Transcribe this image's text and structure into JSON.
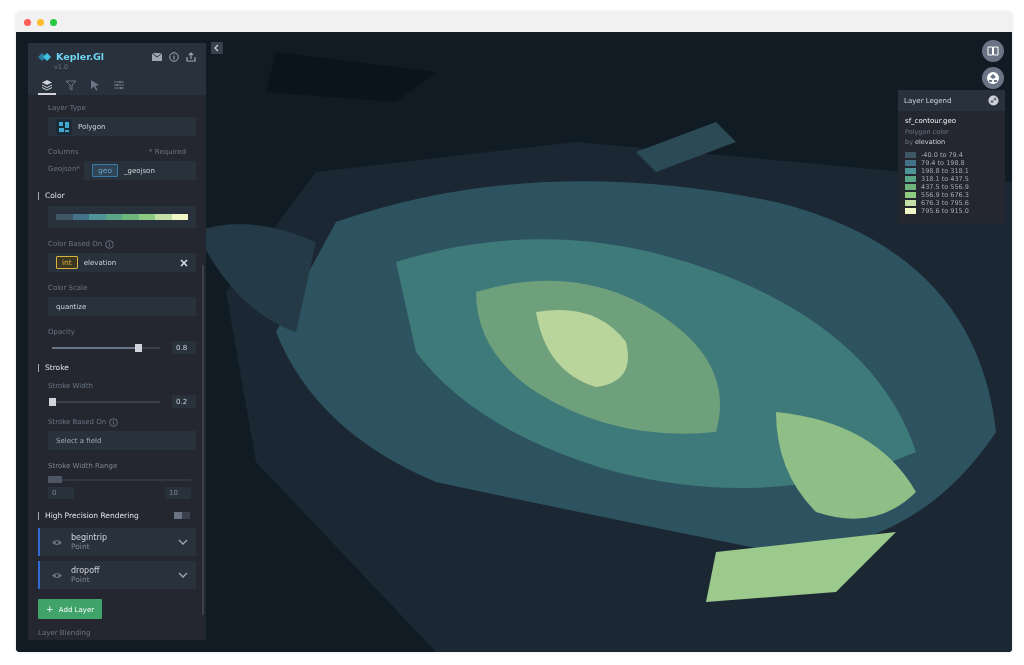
{
  "window": {
    "controls": [
      {
        "color": "#ff5f57"
      },
      {
        "color": "#febc2e"
      },
      {
        "color": "#28c840"
      }
    ]
  },
  "sidebar": {
    "brand": "Kepler.Gl",
    "version": "v1.0",
    "tabs": [
      {
        "kind": "layers",
        "selected": true
      },
      {
        "kind": "filters",
        "selected": false
      },
      {
        "kind": "interactions",
        "selected": false
      },
      {
        "kind": "settings",
        "selected": false
      }
    ],
    "layer_type": {
      "label": "Layer Type",
      "value": "Polygon"
    },
    "columns": {
      "label": "Columns",
      "note": "* Required",
      "field_label": "Geojson*",
      "tag": "geo",
      "value": "_geojson"
    },
    "color": {
      "title": "Color",
      "swatches": [
        {
          "color": "#3e5666"
        },
        {
          "color": "#44728a"
        },
        {
          "color": "#4f9598"
        },
        {
          "color": "#5aa586"
        },
        {
          "color": "#6db57c"
        },
        {
          "color": "#8fca82"
        },
        {
          "color": "#c3dfa6"
        },
        {
          "color": "#f0f6c6"
        }
      ]
    },
    "color_based_on": {
      "label": "Color Based On",
      "tag": "int",
      "value": "elevation"
    },
    "color_scale": {
      "label": "Color Scale",
      "value": "quantize"
    },
    "opacity": {
      "label": "Opacity",
      "level": 0.8,
      "reading": "0.8"
    },
    "stroke": {
      "title": "Stroke",
      "width_label": "Stroke Width",
      "level": 0.0,
      "reading": "0.2"
    },
    "stroke_based_on": {
      "label": "Stroke Based On",
      "placeholder": "Select a field"
    },
    "stroke_width_range": {
      "label": "Stroke Width Range",
      "disabled": true,
      "level": 0.1,
      "min": "0",
      "max": "10"
    },
    "high_precision": {
      "label": "High Precision Rendering",
      "on": false
    },
    "layers": [
      {
        "name": "begintrip",
        "type": "Point"
      },
      {
        "name": "dropoff",
        "type": "Point"
      }
    ],
    "add_layer": "Add Layer",
    "add_symbol": "+",
    "layer_blending": "Layer Blending"
  },
  "legend": {
    "title": "Layer Legend",
    "dataset": "sf_contour.geo",
    "subtitle": "Polygon color",
    "by": "by",
    "field": "elevation",
    "items": [
      {
        "color": "#3e5666",
        "label": "-40.0 to 79.4"
      },
      {
        "color": "#44728a",
        "label": "79.4 to 198.8"
      },
      {
        "color": "#4f9598",
        "label": "198.8 to 318.1"
      },
      {
        "color": "#5aa586",
        "label": "318.1 to 437.5"
      },
      {
        "color": "#6db57c",
        "label": "437.5 to 556.9"
      },
      {
        "color": "#8fca82",
        "label": "556.9 to 676.3"
      },
      {
        "color": "#c3dfa6",
        "label": "676.3 to 795.6"
      },
      {
        "color": "#f0f6c6",
        "label": "795.6 to 915.0"
      }
    ]
  }
}
